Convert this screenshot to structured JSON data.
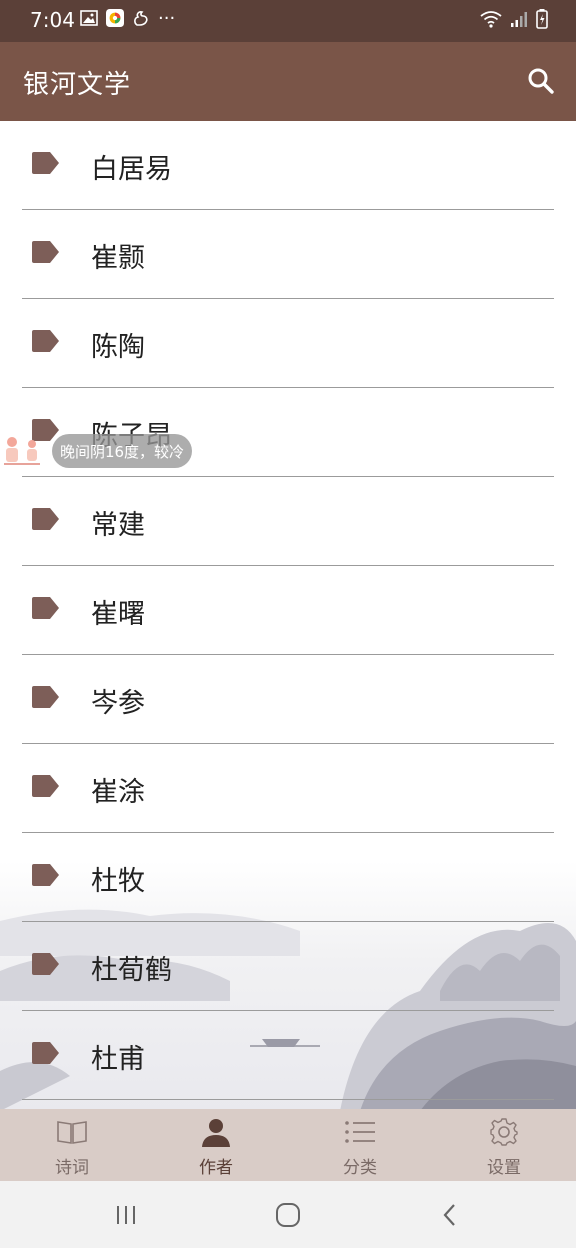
{
  "status_bar": {
    "time": "7:04",
    "left_icons": [
      "image-icon",
      "app-icon",
      "squirrel-icon",
      "more-icon"
    ],
    "more": "···",
    "right_icons": [
      "wifi-icon",
      "signal-icon",
      "battery-icon"
    ]
  },
  "app_bar": {
    "title": "银河文学",
    "search_icon": "search-icon"
  },
  "authors": [
    {
      "label": "白居易"
    },
    {
      "label": "崔颢"
    },
    {
      "label": "陈陶"
    },
    {
      "label": "陈子昂"
    },
    {
      "label": "常建"
    },
    {
      "label": "崔曙"
    },
    {
      "label": "岑参"
    },
    {
      "label": "崔涂"
    },
    {
      "label": "杜牧"
    },
    {
      "label": "杜荀鹤"
    },
    {
      "label": "杜甫"
    }
  ],
  "weather_toast": {
    "text": "晚间阴16度，较冷"
  },
  "bottom_nav": [
    {
      "label": "诗词",
      "icon": "book-icon",
      "active": false
    },
    {
      "label": "作者",
      "icon": "person-icon",
      "active": true
    },
    {
      "label": "分类",
      "icon": "list-icon",
      "active": false
    },
    {
      "label": "设置",
      "icon": "gear-icon",
      "active": false
    }
  ],
  "colors": {
    "status_bar": "#5b4038",
    "app_bar": "#7a5548",
    "tag": "#7d5e58",
    "bottom_nav": "#d9ccc7"
  }
}
